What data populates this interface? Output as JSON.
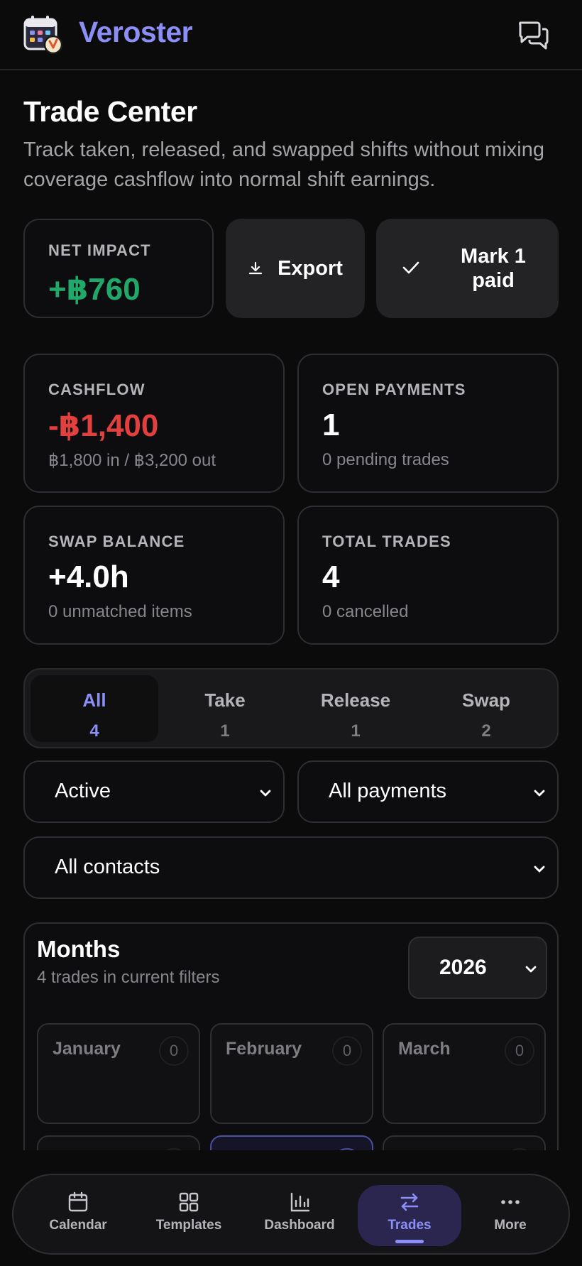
{
  "app": {
    "brand": "Veroster"
  },
  "header": {
    "logo_icon": "calendar-clock-logo-icon",
    "chat_icon": "chat-bubbles-icon"
  },
  "page": {
    "title": "Trade Center",
    "subtitle": "Track taken, released, and swapped shifts without mixing coverage cashflow into normal shift earnings."
  },
  "summary": {
    "net_impact_label": "NET IMPACT",
    "net_impact_value": "+฿760",
    "export_label": "Export",
    "mark_paid_label": "Mark 1 paid"
  },
  "stats": {
    "cashflow": {
      "label": "CASHFLOW",
      "value": "-฿1,400",
      "sub": "฿1,800 in / ฿3,200 out"
    },
    "open_payments": {
      "label": "OPEN PAYMENTS",
      "value": "1",
      "sub": "0 pending trades"
    },
    "swap_balance": {
      "label": "SWAP BALANCE",
      "value": "+4.0h",
      "sub": "0 unmatched items"
    },
    "total_trades": {
      "label": "TOTAL TRADES",
      "value": "4",
      "sub": "0 cancelled"
    }
  },
  "tabs": [
    {
      "label": "All",
      "count": "4",
      "active": true
    },
    {
      "label": "Take",
      "count": "1"
    },
    {
      "label": "Release",
      "count": "1"
    },
    {
      "label": "Swap",
      "count": "2"
    }
  ],
  "filters": {
    "status": "Active",
    "payments": "All payments",
    "contacts": "All contacts"
  },
  "months": {
    "title": "Months",
    "subtitle": "4 trades in current filters",
    "year": "2026",
    "items": [
      {
        "name": "January",
        "count": "0"
      },
      {
        "name": "February",
        "count": "0"
      },
      {
        "name": "March",
        "count": "0"
      }
    ]
  },
  "nav": [
    {
      "label": "Calendar",
      "icon": "calendar-icon"
    },
    {
      "label": "Templates",
      "icon": "grid-icon"
    },
    {
      "label": "Dashboard",
      "icon": "bar-chart-icon"
    },
    {
      "label": "Trades",
      "icon": "swap-arrows-icon",
      "active": true
    },
    {
      "label": "More",
      "icon": "more-dots-icon"
    }
  ],
  "colors": {
    "accent": "#8b8ff5",
    "positive": "#1fa86a",
    "negative": "#e2403e",
    "background": "#0b0b0c"
  }
}
